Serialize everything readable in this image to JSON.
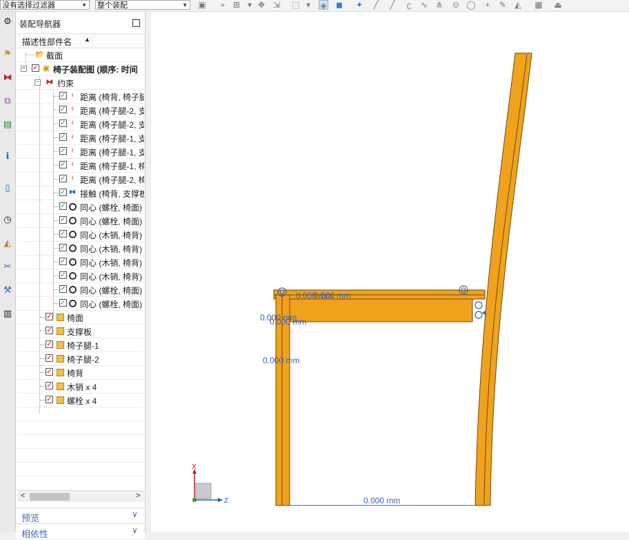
{
  "toolbar": {
    "filter_combo": "没有选择过滤器",
    "scope_combo": "整个装配"
  },
  "navigator": {
    "title": "装配导航器",
    "column_header": "描述性部件名",
    "hscroll_left": "<",
    "hscroll_right": ">",
    "rows": [
      {
        "label": "截面"
      },
      {
        "label": "椅子装配图 (顺序: 时间"
      },
      {
        "label": "约束"
      },
      {
        "label": "距离 (椅背, 椅子腿"
      },
      {
        "label": "距离 (椅子腿-2, 支"
      },
      {
        "label": "距离 (椅子腿-2, 支"
      },
      {
        "label": "距离 (椅子腿-1, 支"
      },
      {
        "label": "距离 (椅子腿-1, 支"
      },
      {
        "label": "距离 (椅子腿-1, 椅"
      },
      {
        "label": "距离 (椅子腿-2, 椅"
      },
      {
        "label": "接触 (椅背, 支撑板"
      },
      {
        "label": "同心 (螺栓, 椅面)"
      },
      {
        "label": "同心 (螺栓, 椅面)"
      },
      {
        "label": "同心 (木销, 椅背)"
      },
      {
        "label": "同心 (木销, 椅背)"
      },
      {
        "label": "同心 (木销, 椅背)"
      },
      {
        "label": "同心 (木销, 椅背)"
      },
      {
        "label": "同心 (螺栓, 椅面)"
      },
      {
        "label": "同心 (螺栓, 椅面)"
      },
      {
        "label": "椅面"
      },
      {
        "label": "支撑板"
      },
      {
        "label": "椅子腿-1"
      },
      {
        "label": "椅子腿-2"
      },
      {
        "label": "椅背"
      },
      {
        "label": "木销 x 4"
      },
      {
        "label": "螺栓 x 4"
      }
    ],
    "sections": [
      {
        "label": "预览"
      },
      {
        "label": "相依性"
      }
    ]
  },
  "viewport": {
    "dims": [
      "0.000 mm",
      "0.000 mm",
      "0.000 mm",
      "0.000 mm",
      "0.000 mm",
      "0.000 mm"
    ],
    "triad_x": "X",
    "triad_z": "Z",
    "chair_color": "#f0a21d",
    "dim_color": "#3d5fb5"
  }
}
